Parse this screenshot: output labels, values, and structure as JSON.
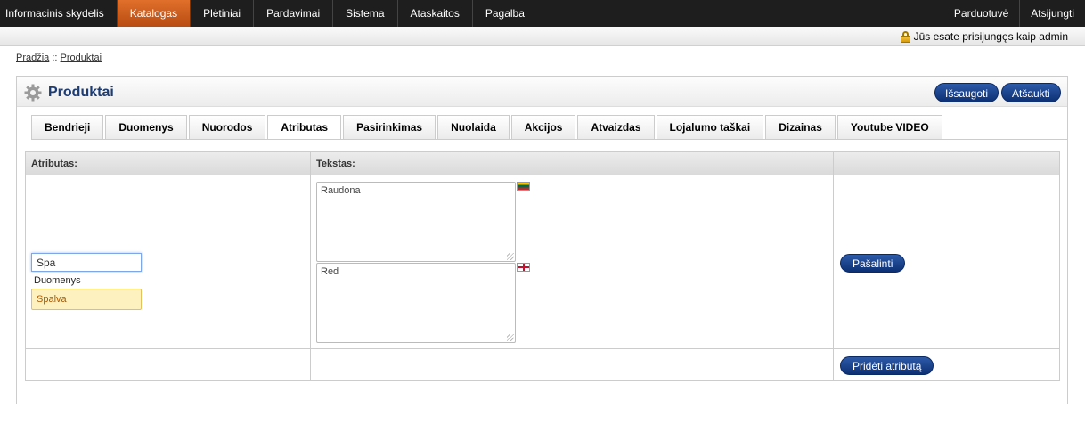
{
  "topnav": {
    "items": [
      "Informacinis skydelis",
      "Katalogas",
      "Plėtiniai",
      "Pardavimai",
      "Sistema",
      "Ataskaitos",
      "Pagalba"
    ],
    "active": "Katalogas",
    "right": [
      "Parduotuvė",
      "Atsijungti"
    ]
  },
  "userbar": {
    "login_text": "Jūs esate prisijungęs kaip admin"
  },
  "breadcrumb": {
    "home": "Pradžia",
    "separator": "::",
    "current": "Produktai"
  },
  "page": {
    "title": "Produktai",
    "save_label": "Išsaugoti",
    "cancel_label": "Atšaukti"
  },
  "tabs": [
    "Bendrieji",
    "Duomenys",
    "Nuorodos",
    "Atributas",
    "Pasirinkimas",
    "Nuolaida",
    "Akcijos",
    "Atvaizdas",
    "Lojalumo taškai",
    "Dizainas",
    "Youtube VIDEO"
  ],
  "active_tab": "Atributas",
  "attributes": {
    "col_attribute": "Atributas:",
    "col_text": "Tekstas:",
    "row": {
      "attribute_value": "Spa",
      "suggestions": [
        "Duomenys",
        "Spalva"
      ],
      "highlighted_suggestion": "Spalva",
      "text_lt": "Raudona",
      "text_en": "Red",
      "remove_label": "Pašalinti"
    },
    "add_label": "Pridėti atributą"
  },
  "colors": {
    "accent": "#0d3074",
    "active_menu": "#d0601e"
  }
}
